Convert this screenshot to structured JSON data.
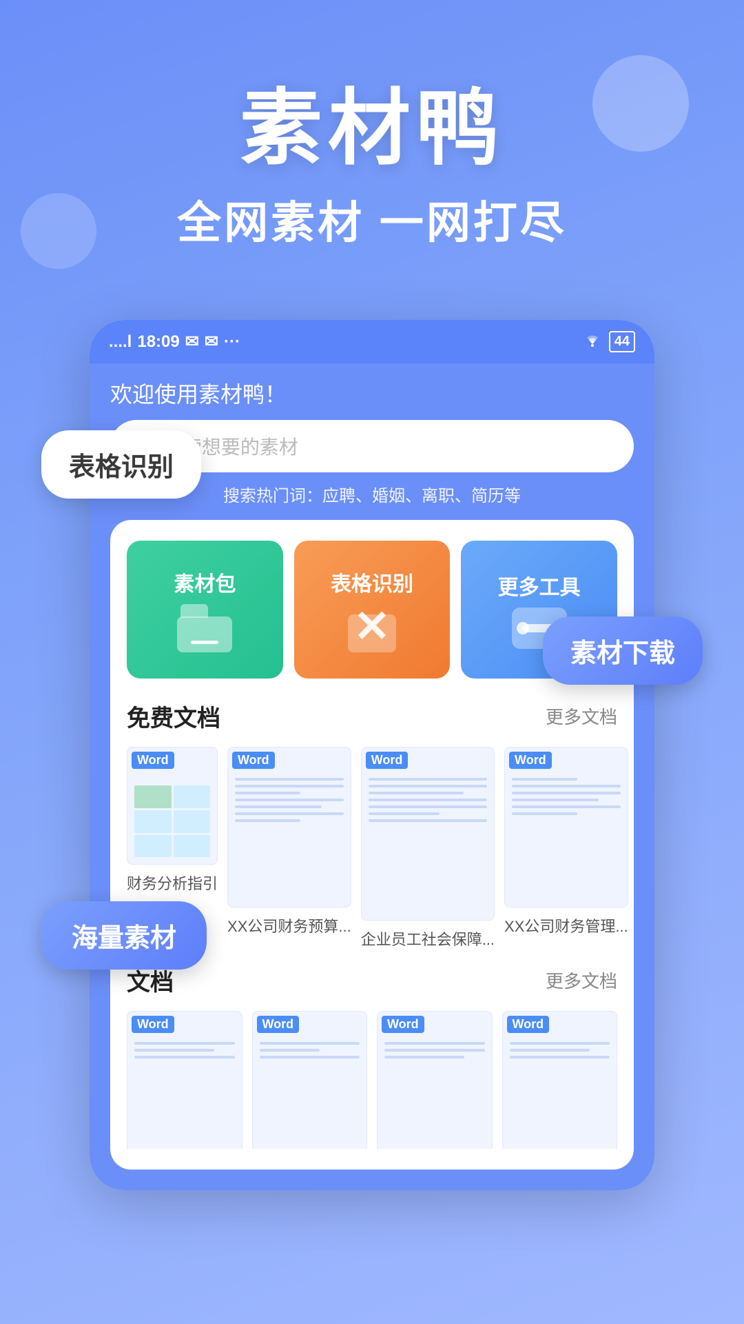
{
  "hero": {
    "title": "素材鸭",
    "subtitle": "全网素材   一网打尽"
  },
  "phone": {
    "status_bar": {
      "time": "18:09",
      "signal": "📶",
      "wifi": "WiFi",
      "battery": "44"
    },
    "welcome": "欢迎使用素材鸭！",
    "search": {
      "placeholder": "搜索想要的素材",
      "hot_label": "搜索热门词：应聘、婚姻、离职、简历等"
    },
    "features": [
      {
        "label": "素材包",
        "type": "green"
      },
      {
        "label": "表格识别",
        "type": "orange"
      },
      {
        "label": "更多工具",
        "type": "blue"
      }
    ],
    "free_docs": {
      "title": "免费文档",
      "more": "更多文档",
      "items": [
        {
          "badge": "Word",
          "caption": "财务分析指引"
        },
        {
          "badge": "Word",
          "caption": "XX公司财务预算..."
        },
        {
          "badge": "Word",
          "caption": "企业员工社会保障..."
        },
        {
          "badge": "Word",
          "caption": "XX公司财务管理..."
        }
      ]
    },
    "second_section": {
      "title": "文档",
      "more": "更多文档",
      "items": [
        {
          "badge": "Word",
          "caption": ""
        },
        {
          "badge": "Word",
          "caption": ""
        },
        {
          "badge": "Word",
          "caption": ""
        },
        {
          "badge": "Word",
          "caption": ""
        }
      ]
    }
  },
  "float_labels": {
    "table_recognition": "表格识别",
    "material_download": "素材下载",
    "massive_material": "海量素材"
  }
}
